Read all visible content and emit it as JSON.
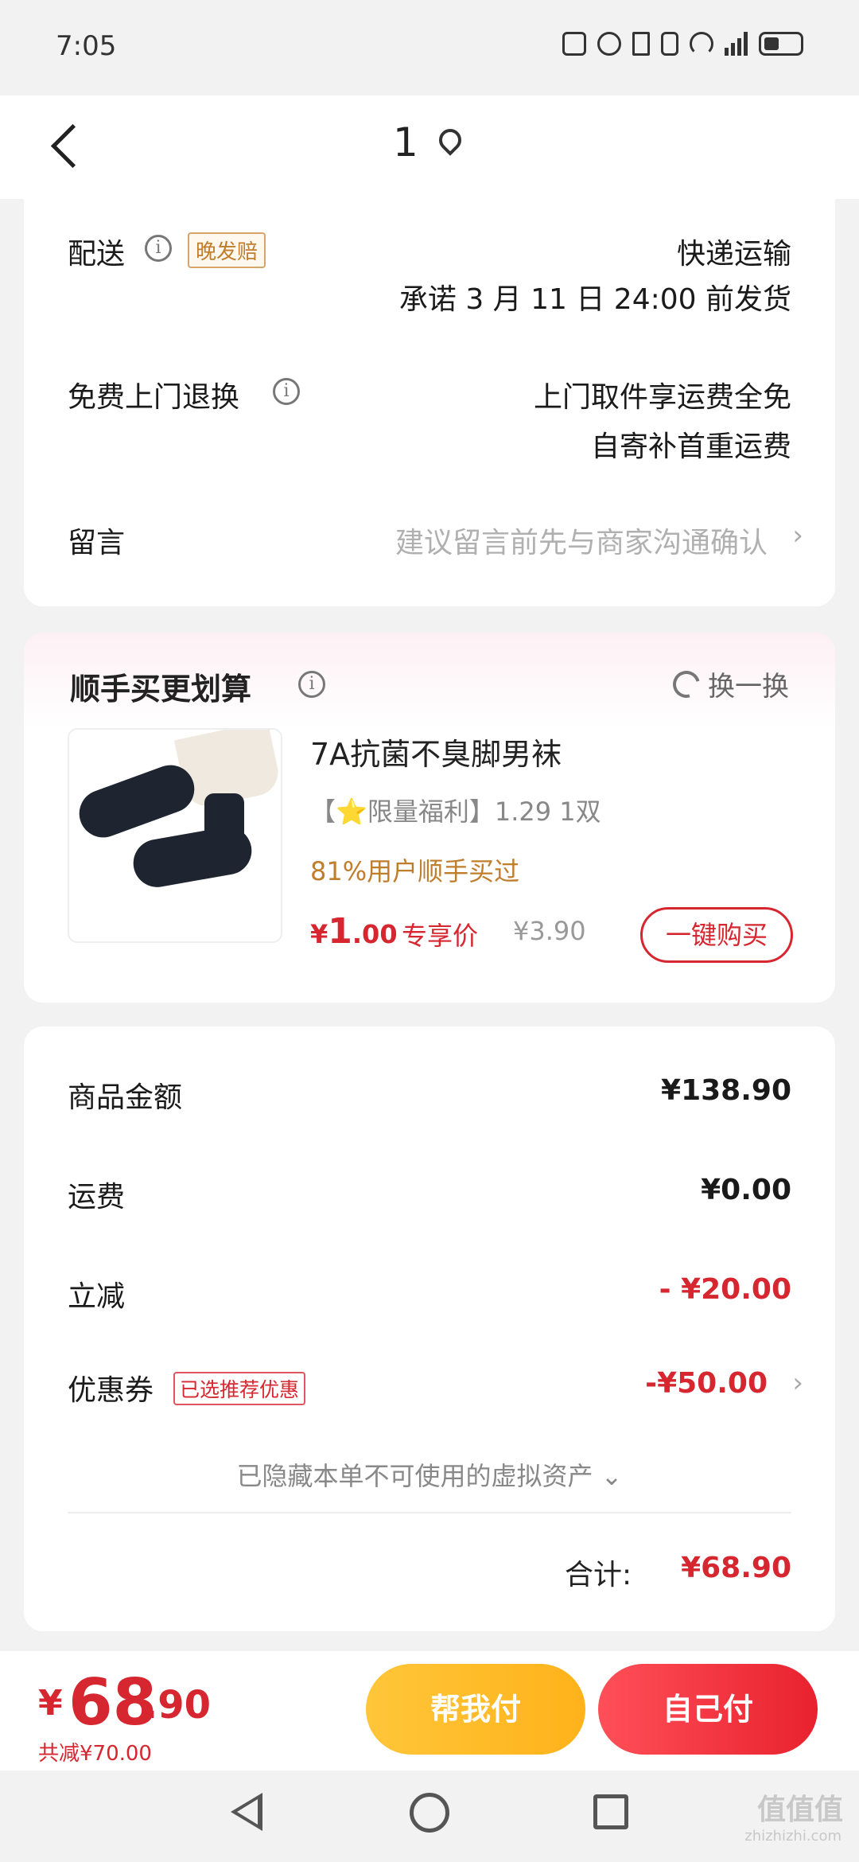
{
  "status": {
    "time": "7:05",
    "icons": [
      "nfc-icon",
      "alarm-icon",
      "bluetooth-icon",
      "vibrate-icon",
      "wifi-icon",
      "signal-5g-icon",
      "battery-icon"
    ]
  },
  "nav": {
    "title": "1",
    "icon": "location-pin-icon"
  },
  "delivery": {
    "label": "配送",
    "tag": "晚发赔",
    "method": "快递运输",
    "promise": "承诺 3 月 11 日 24:00 前发货"
  },
  "returns": {
    "label": "免费上门退换",
    "line1": "上门取件享运费全免",
    "line2": "自寄补首重运费"
  },
  "message": {
    "label": "留言",
    "placeholder": "建议留言前先与商家沟通确认"
  },
  "upsell": {
    "title": "顺手买更划算",
    "swap_label": "换一换",
    "product": {
      "name": "7A抗菌不臭脚男袜",
      "benefit": "【⭐限量福利】1.29 1双",
      "bought": "81%用户顺手买过",
      "price_symbol": "¥",
      "price_int": "1",
      "price_dec": ".00",
      "exclusive": "专享价",
      "original_price": "¥3.90",
      "buy_label": "一键购买"
    }
  },
  "summary": {
    "goods_label": "商品金额",
    "goods_value": "¥138.90",
    "shipping_label": "运费",
    "shipping_value": "¥0.00",
    "discount_label": "立减",
    "discount_value": "- ¥20.00",
    "coupon_label": "优惠券",
    "coupon_tag": "已选推荐优惠",
    "coupon_value": "-¥50.00",
    "hidden_assets": "已隐藏本单不可使用的虚拟资产 ⌄",
    "total_label": "合计:",
    "total_value": "¥68.90"
  },
  "bottom": {
    "pay_symbol": "¥",
    "pay_int": "68",
    "pay_dec": ".90",
    "saved": "共减¥70.00",
    "help_pay": "帮我付",
    "self_pay": "自己付"
  },
  "watermark": {
    "text": "值值值",
    "sub": "zhizhizhi.com"
  },
  "colors": {
    "accent_red": "#d6262f",
    "accent_orange": "#c07d2c",
    "help_button": "#ffb21a"
  }
}
